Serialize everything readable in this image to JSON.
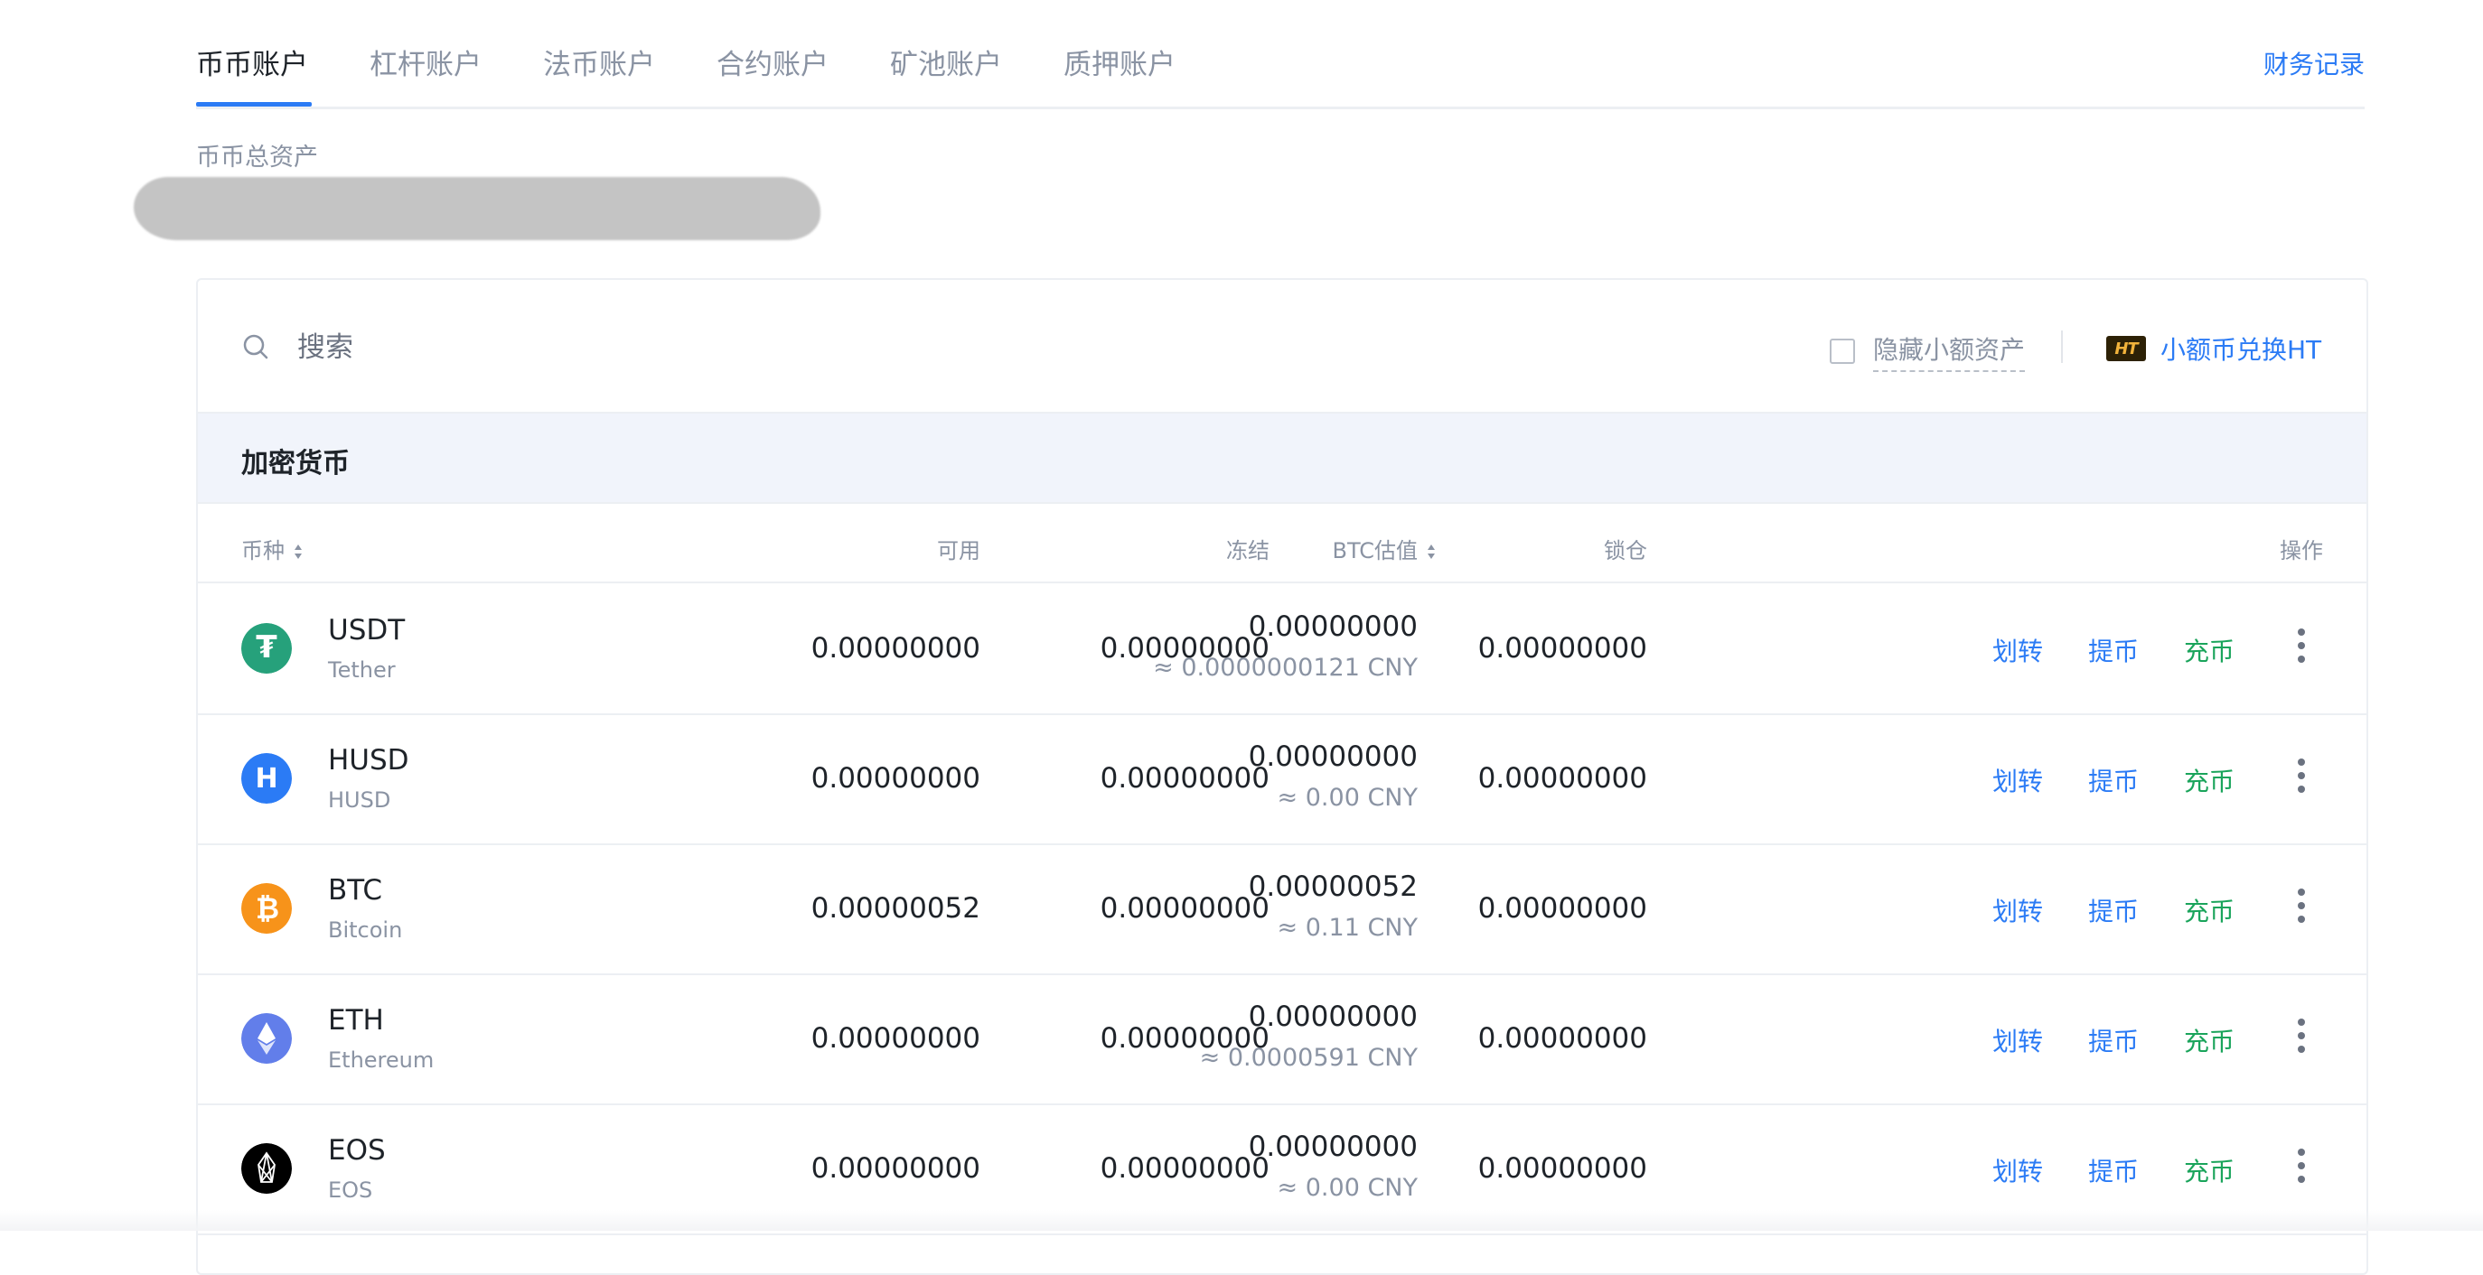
{
  "tabs": [
    {
      "label": "币币账户",
      "active": true
    },
    {
      "label": "杠杆账户"
    },
    {
      "label": "法币账户"
    },
    {
      "label": "合约账户"
    },
    {
      "label": "矿池账户"
    },
    {
      "label": "质押账户"
    }
  ],
  "finance_records": "财务记录",
  "total_assets_label": "币币总资产",
  "search": {
    "placeholder": "搜索",
    "value": ""
  },
  "hide_small_assets": "隐藏小额资产",
  "ht_exchange": {
    "icon_text": "HT",
    "label": "小额币兑换HT"
  },
  "section_title": "加密货币",
  "columns": {
    "coin": "币种",
    "available": "可用",
    "frozen": "冻结",
    "btc_value": "BTC估值",
    "locked": "锁仓",
    "actions": "操作"
  },
  "rows": [
    {
      "symbol": "USDT",
      "name": "Tether",
      "available": "0.00000000",
      "frozen": "0.00000000",
      "btc": "0.00000000",
      "cny": "≈ 0.0000000121 CNY",
      "locked": "0.00000000",
      "icon": "tether-icon",
      "icon_bg": "#26a17b"
    },
    {
      "symbol": "HUSD",
      "name": "HUSD",
      "available": "0.00000000",
      "frozen": "0.00000000",
      "btc": "0.00000000",
      "cny": "≈ 0.00 CNY",
      "locked": "0.00000000",
      "icon": "husd-icon",
      "icon_bg": "#2b7bf5"
    },
    {
      "symbol": "BTC",
      "name": "Bitcoin",
      "available": "0.00000052",
      "frozen": "0.00000000",
      "btc": "0.00000052",
      "cny": "≈ 0.11 CNY",
      "locked": "0.00000000",
      "icon": "bitcoin-icon",
      "icon_bg": "#f7931a"
    },
    {
      "symbol": "ETH",
      "name": "Ethereum",
      "available": "0.00000000",
      "frozen": "0.00000000",
      "btc": "0.00000000",
      "cny": "≈ 0.0000591 CNY",
      "locked": "0.00000000",
      "icon": "ethereum-icon",
      "icon_bg": "#627eea"
    },
    {
      "symbol": "EOS",
      "name": "EOS",
      "available": "0.00000000",
      "frozen": "0.00000000",
      "btc": "0.00000000",
      "cny": "≈ 0.00 CNY",
      "locked": "0.00000000",
      "icon": "eos-icon",
      "icon_bg": "#000000"
    }
  ],
  "actions": {
    "transfer": "划转",
    "withdraw": "提币",
    "deposit": "充币"
  },
  "colors": {
    "accent": "#2b7bf5",
    "deposit": "#1aa45b",
    "muted": "#8a93a3",
    "section_bg": "#f1f4fb"
  }
}
